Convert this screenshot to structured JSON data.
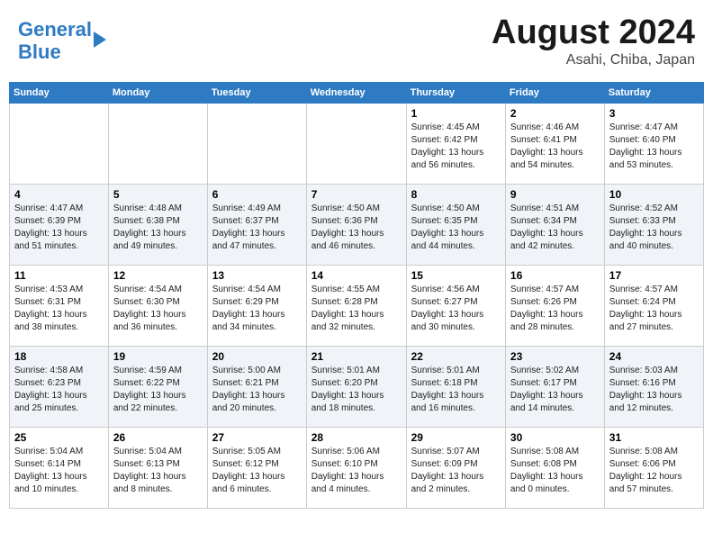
{
  "header": {
    "logo_line1": "General",
    "logo_line2": "Blue",
    "title": "August 2024",
    "location": "Asahi, Chiba, Japan"
  },
  "days_of_week": [
    "Sunday",
    "Monday",
    "Tuesday",
    "Wednesday",
    "Thursday",
    "Friday",
    "Saturday"
  ],
  "weeks": [
    [
      {
        "num": "",
        "info": ""
      },
      {
        "num": "",
        "info": ""
      },
      {
        "num": "",
        "info": ""
      },
      {
        "num": "",
        "info": ""
      },
      {
        "num": "1",
        "info": "Sunrise: 4:45 AM\nSunset: 6:42 PM\nDaylight: 13 hours\nand 56 minutes."
      },
      {
        "num": "2",
        "info": "Sunrise: 4:46 AM\nSunset: 6:41 PM\nDaylight: 13 hours\nand 54 minutes."
      },
      {
        "num": "3",
        "info": "Sunrise: 4:47 AM\nSunset: 6:40 PM\nDaylight: 13 hours\nand 53 minutes."
      }
    ],
    [
      {
        "num": "4",
        "info": "Sunrise: 4:47 AM\nSunset: 6:39 PM\nDaylight: 13 hours\nand 51 minutes."
      },
      {
        "num": "5",
        "info": "Sunrise: 4:48 AM\nSunset: 6:38 PM\nDaylight: 13 hours\nand 49 minutes."
      },
      {
        "num": "6",
        "info": "Sunrise: 4:49 AM\nSunset: 6:37 PM\nDaylight: 13 hours\nand 47 minutes."
      },
      {
        "num": "7",
        "info": "Sunrise: 4:50 AM\nSunset: 6:36 PM\nDaylight: 13 hours\nand 46 minutes."
      },
      {
        "num": "8",
        "info": "Sunrise: 4:50 AM\nSunset: 6:35 PM\nDaylight: 13 hours\nand 44 minutes."
      },
      {
        "num": "9",
        "info": "Sunrise: 4:51 AM\nSunset: 6:34 PM\nDaylight: 13 hours\nand 42 minutes."
      },
      {
        "num": "10",
        "info": "Sunrise: 4:52 AM\nSunset: 6:33 PM\nDaylight: 13 hours\nand 40 minutes."
      }
    ],
    [
      {
        "num": "11",
        "info": "Sunrise: 4:53 AM\nSunset: 6:31 PM\nDaylight: 13 hours\nand 38 minutes."
      },
      {
        "num": "12",
        "info": "Sunrise: 4:54 AM\nSunset: 6:30 PM\nDaylight: 13 hours\nand 36 minutes."
      },
      {
        "num": "13",
        "info": "Sunrise: 4:54 AM\nSunset: 6:29 PM\nDaylight: 13 hours\nand 34 minutes."
      },
      {
        "num": "14",
        "info": "Sunrise: 4:55 AM\nSunset: 6:28 PM\nDaylight: 13 hours\nand 32 minutes."
      },
      {
        "num": "15",
        "info": "Sunrise: 4:56 AM\nSunset: 6:27 PM\nDaylight: 13 hours\nand 30 minutes."
      },
      {
        "num": "16",
        "info": "Sunrise: 4:57 AM\nSunset: 6:26 PM\nDaylight: 13 hours\nand 28 minutes."
      },
      {
        "num": "17",
        "info": "Sunrise: 4:57 AM\nSunset: 6:24 PM\nDaylight: 13 hours\nand 27 minutes."
      }
    ],
    [
      {
        "num": "18",
        "info": "Sunrise: 4:58 AM\nSunset: 6:23 PM\nDaylight: 13 hours\nand 25 minutes."
      },
      {
        "num": "19",
        "info": "Sunrise: 4:59 AM\nSunset: 6:22 PM\nDaylight: 13 hours\nand 22 minutes."
      },
      {
        "num": "20",
        "info": "Sunrise: 5:00 AM\nSunset: 6:21 PM\nDaylight: 13 hours\nand 20 minutes."
      },
      {
        "num": "21",
        "info": "Sunrise: 5:01 AM\nSunset: 6:20 PM\nDaylight: 13 hours\nand 18 minutes."
      },
      {
        "num": "22",
        "info": "Sunrise: 5:01 AM\nSunset: 6:18 PM\nDaylight: 13 hours\nand 16 minutes."
      },
      {
        "num": "23",
        "info": "Sunrise: 5:02 AM\nSunset: 6:17 PM\nDaylight: 13 hours\nand 14 minutes."
      },
      {
        "num": "24",
        "info": "Sunrise: 5:03 AM\nSunset: 6:16 PM\nDaylight: 13 hours\nand 12 minutes."
      }
    ],
    [
      {
        "num": "25",
        "info": "Sunrise: 5:04 AM\nSunset: 6:14 PM\nDaylight: 13 hours\nand 10 minutes."
      },
      {
        "num": "26",
        "info": "Sunrise: 5:04 AM\nSunset: 6:13 PM\nDaylight: 13 hours\nand 8 minutes."
      },
      {
        "num": "27",
        "info": "Sunrise: 5:05 AM\nSunset: 6:12 PM\nDaylight: 13 hours\nand 6 minutes."
      },
      {
        "num": "28",
        "info": "Sunrise: 5:06 AM\nSunset: 6:10 PM\nDaylight: 13 hours\nand 4 minutes."
      },
      {
        "num": "29",
        "info": "Sunrise: 5:07 AM\nSunset: 6:09 PM\nDaylight: 13 hours\nand 2 minutes."
      },
      {
        "num": "30",
        "info": "Sunrise: 5:08 AM\nSunset: 6:08 PM\nDaylight: 13 hours\nand 0 minutes."
      },
      {
        "num": "31",
        "info": "Sunrise: 5:08 AM\nSunset: 6:06 PM\nDaylight: 12 hours\nand 57 minutes."
      }
    ]
  ]
}
